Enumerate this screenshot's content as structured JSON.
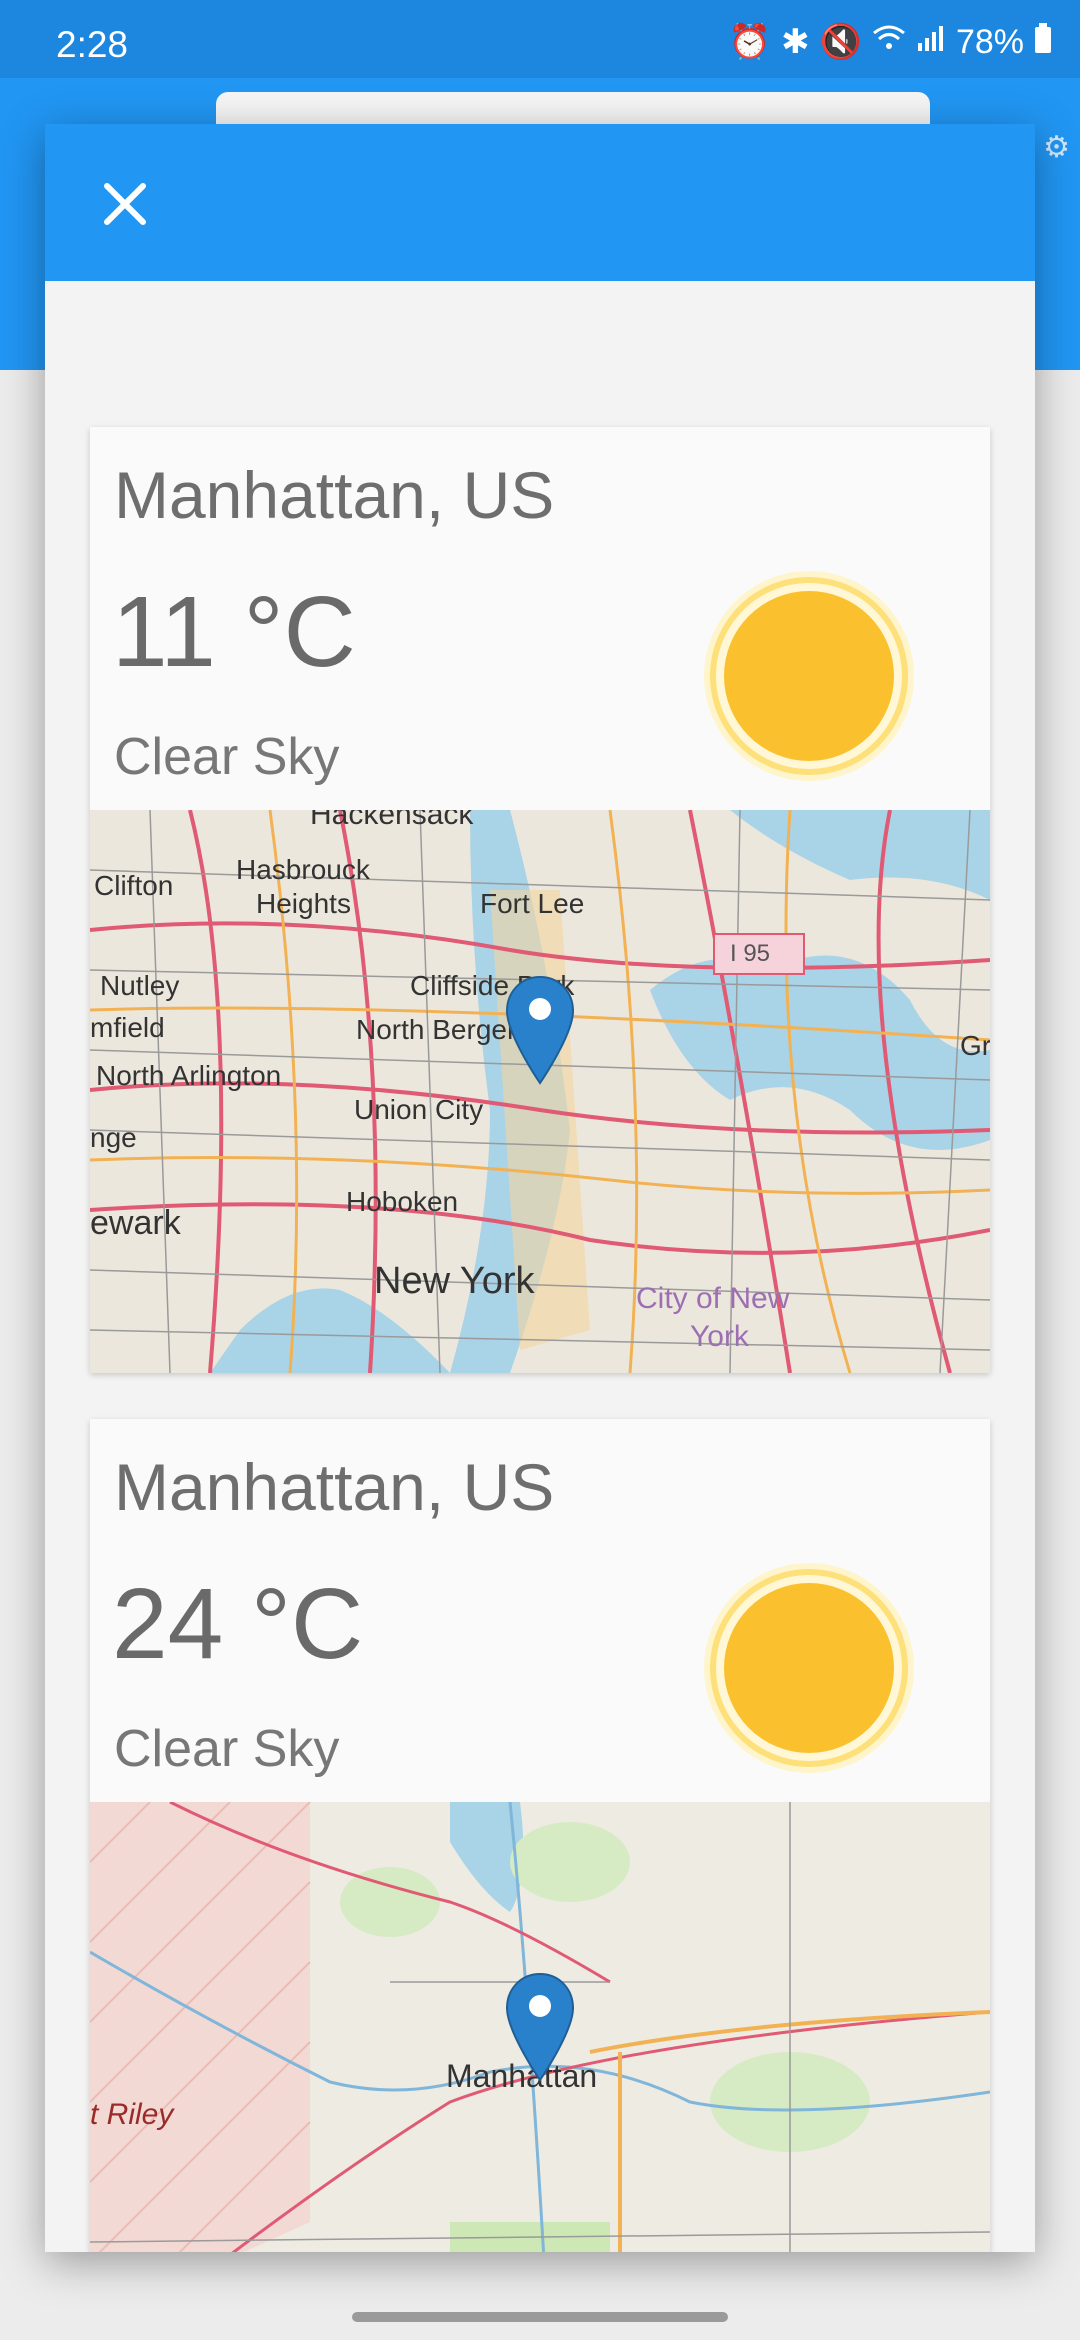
{
  "status_bar": {
    "time": "2:28",
    "battery": "78%"
  },
  "icons": {
    "close": "close-icon",
    "alarm": "alarm-icon",
    "bluetooth": "bluetooth-icon",
    "mute": "mute-icon",
    "wifi": "wifi-icon",
    "signal": "signal-icon",
    "battery": "battery-icon",
    "weather": "sun-icon",
    "marker": "map-pin-icon"
  },
  "colors": {
    "app_bar": "#2196f3",
    "status_bar": "#1d86df",
    "sun": "#fbc02d"
  },
  "cards": [
    {
      "city": "Manhattan, US",
      "temperature": "11 °C",
      "condition": "Clear Sky",
      "map_labels": {
        "hackensack": "Hackensack",
        "clifton": "Clifton",
        "hasbrouck": "Hasbrouck",
        "heights": "Heights",
        "fort_lee": "Fort Lee",
        "nutley": "Nutley",
        "cliffside": "Cliffside Park",
        "mfield": "mfield",
        "north_bergen": "North Bergen",
        "north_arlington": "North Arlington",
        "union_city": "Union City",
        "nge": "nge",
        "hoboken": "Hoboken",
        "newark": "ewark",
        "new_york": "New York",
        "city_of_new": "City of New",
        "york": "York",
        "i95": "I 95",
        "gr": "Gr"
      }
    },
    {
      "city": "Manhattan, US",
      "temperature": "24 °C",
      "condition": "Clear Sky",
      "map_labels": {
        "manhattan": "Manhattan",
        "riley": "t Riley"
      }
    }
  ]
}
